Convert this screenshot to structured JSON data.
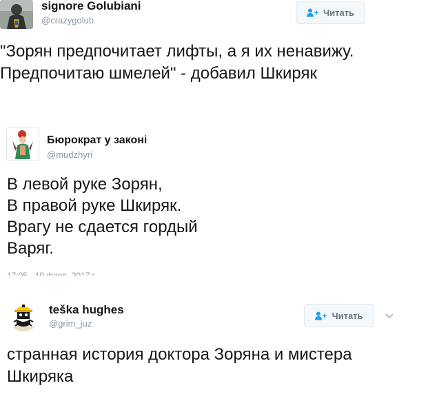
{
  "tweets": [
    {
      "name": "signore Golubiani",
      "handle": "@crazygolub",
      "follow_label": "Читать",
      "text": "\"Зорян предпочитает лифты, а я их ненавижу. Предпочитаю шмелей\" - добавил Шкиряк"
    },
    {
      "name": "Бюрократ у законі",
      "handle": "@mudzhyri",
      "text": "В левой руке Зорян,\nВ правой руке Шкиряк.\nВрагу не сдается гордый\nВаряг.",
      "timestamp": "17:05 - 10 февр. 2017 г."
    },
    {
      "name": "teška hughes",
      "handle": "@grim_juz",
      "follow_label": "Читать",
      "text": "странная история доктора Зоряна и мистера Шкиряка"
    }
  ],
  "icons": {
    "follow": "add-user-icon",
    "more": "chevron-down-icon"
  },
  "colors": {
    "text": "#14171a",
    "secondary": "#8899a6",
    "accent": "#1da1f2",
    "button_bg": "#f5f8fa",
    "button_border": "#e1e8ed"
  }
}
